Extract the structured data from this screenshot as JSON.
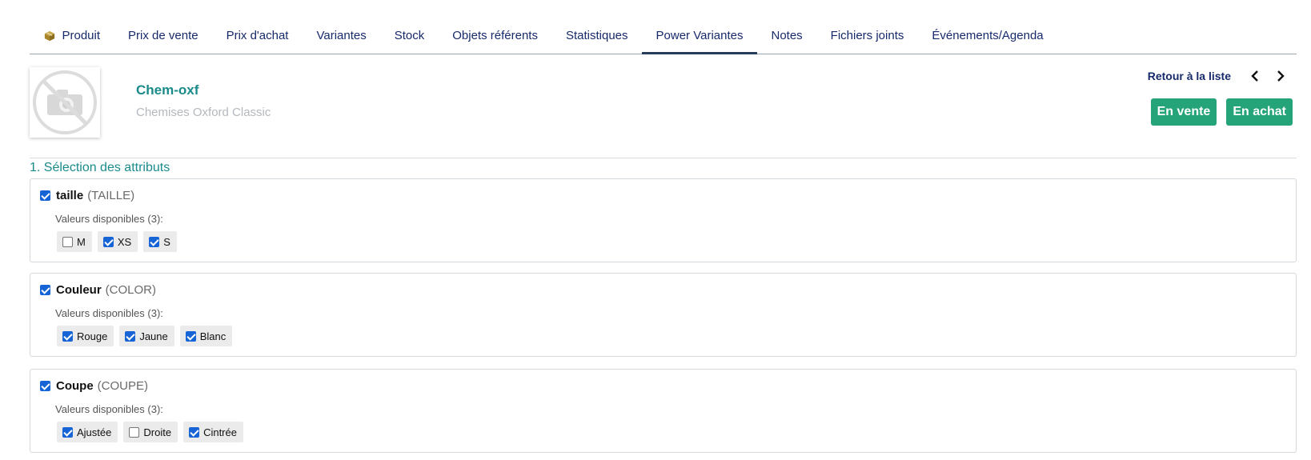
{
  "tabs": [
    {
      "label": "Produit",
      "icon": "product-cube-icon"
    },
    {
      "label": "Prix de vente"
    },
    {
      "label": "Prix d'achat"
    },
    {
      "label": "Variantes"
    },
    {
      "label": "Stock"
    },
    {
      "label": "Objets référents"
    },
    {
      "label": "Statistiques"
    },
    {
      "label": "Power Variantes",
      "active": true
    },
    {
      "label": "Notes"
    },
    {
      "label": "Fichiers joints"
    },
    {
      "label": "Événements/Agenda"
    }
  ],
  "product": {
    "ref": "Chem-oxf",
    "label": "Chemises Oxford Classic",
    "photo_icon": "no-photo-icon"
  },
  "nav": {
    "back_label": "Retour à la liste",
    "prev_icon": "chevron-left-icon",
    "next_icon": "chevron-right-icon"
  },
  "status": {
    "sell_label": "En vente",
    "buy_label": "En achat",
    "color": "#25a47a"
  },
  "section": {
    "title": "1. Sélection des attributs"
  },
  "attributes": [
    {
      "checked": true,
      "name": "taille",
      "code": "(TAILLE)",
      "available": "Valeurs disponibles (3):",
      "values": [
        {
          "label": "M",
          "checked": false
        },
        {
          "label": "XS",
          "checked": true
        },
        {
          "label": "S",
          "checked": true
        }
      ]
    },
    {
      "checked": true,
      "name": "Couleur",
      "code": "(COLOR)",
      "available": "Valeurs disponibles (3):",
      "values": [
        {
          "label": "Rouge",
          "checked": true
        },
        {
          "label": "Jaune",
          "checked": true
        },
        {
          "label": "Blanc",
          "checked": true
        }
      ]
    },
    {
      "checked": true,
      "name": "Coupe",
      "code": "(COUPE)",
      "available": "Valeurs disponibles (3):",
      "values": [
        {
          "label": "Ajustée",
          "checked": true
        },
        {
          "label": "Droite",
          "checked": false
        },
        {
          "label": "Cintrée",
          "checked": true
        }
      ]
    }
  ]
}
